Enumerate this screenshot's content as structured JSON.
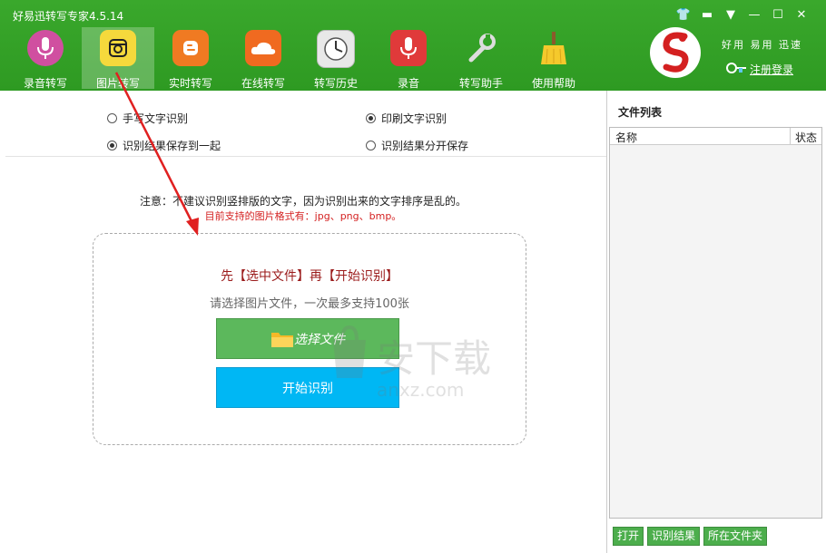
{
  "window": {
    "title": "好易迅转写专家4.5.14"
  },
  "toolbar": [
    {
      "label": "录音转写",
      "icon": "microphone-pink-icon",
      "color": "#d04fa0"
    },
    {
      "label": "图片转写",
      "icon": "camera-icon",
      "color": "#f5d93c",
      "active": true
    },
    {
      "label": "实时转写",
      "icon": "blogger-icon",
      "color": "#f07a22"
    },
    {
      "label": "在线转写",
      "icon": "cloud-icon",
      "color": "#f06a20"
    },
    {
      "label": "转写历史",
      "icon": "clock-icon",
      "color": "#e8e8e8"
    },
    {
      "label": "录音",
      "icon": "microphone-red-icon",
      "color": "#e03a3a"
    },
    {
      "label": "转写助手",
      "icon": "wrench-icon",
      "color": "#d8d8d8"
    },
    {
      "label": "使用帮助",
      "icon": "broom-icon",
      "color": "#f5c92c"
    }
  ],
  "brand": {
    "slogan": "好用 易用 迅速",
    "register": "注册登录"
  },
  "options": {
    "handwriting": "手写文字识别",
    "print": "印刷文字识别",
    "save_together": "识别结果保存到一起",
    "save_separately": "识别结果分开保存"
  },
  "notice": {
    "line1": "注意：不建议识别竖排版的文字，因为识别出来的文字排序是乱的。",
    "line2": "目前支持的图片格式有：jpg、png、bmp。"
  },
  "dropzone": {
    "title": "先【选中文件】再【开始识别】",
    "subtitle": "请选择图片文件，一次最多支持100张",
    "select_label": "选择文件",
    "start_label": "开始识别"
  },
  "filelist": {
    "title": "文件列表",
    "col_name": "名称",
    "col_status": "状态",
    "btn_open": "打开",
    "btn_result": "识别结果",
    "btn_folder": "所在文件夹"
  },
  "watermark": {
    "text": "安下载",
    "sub": "anxz.com"
  }
}
